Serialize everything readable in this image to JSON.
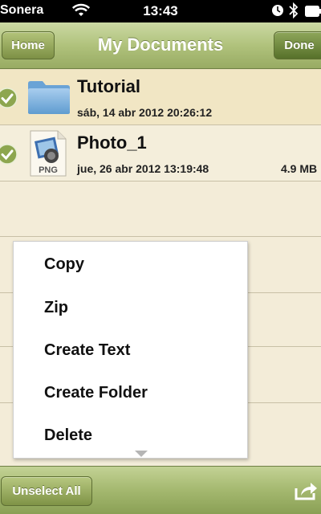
{
  "status_bar": {
    "carrier": "Sonera",
    "time": "13:43"
  },
  "nav": {
    "title": "My Documents",
    "home_label": "Home",
    "done_label": "Done"
  },
  "files": [
    {
      "name": "Tutorial",
      "date": "sáb, 14 abr 2012 20:26:12",
      "size": "",
      "icon": "folder-icon",
      "selected": true
    },
    {
      "name": "Photo_1",
      "date": "jue, 26 abr 2012 13:19:48",
      "size": "4.9 MB",
      "icon": "png-file-icon",
      "badge": "PNG",
      "selected": true
    }
  ],
  "menu": {
    "items": [
      "Copy",
      "Zip",
      "Create Text",
      "Create Folder",
      "Delete"
    ]
  },
  "toolbar": {
    "unselect_label": "Unselect All"
  },
  "colors": {
    "nav_green": "#b0c27c",
    "check_green": "#8da64f",
    "folder_blue": "#7eb2dc",
    "row_highlight": "#f1e6c4"
  }
}
